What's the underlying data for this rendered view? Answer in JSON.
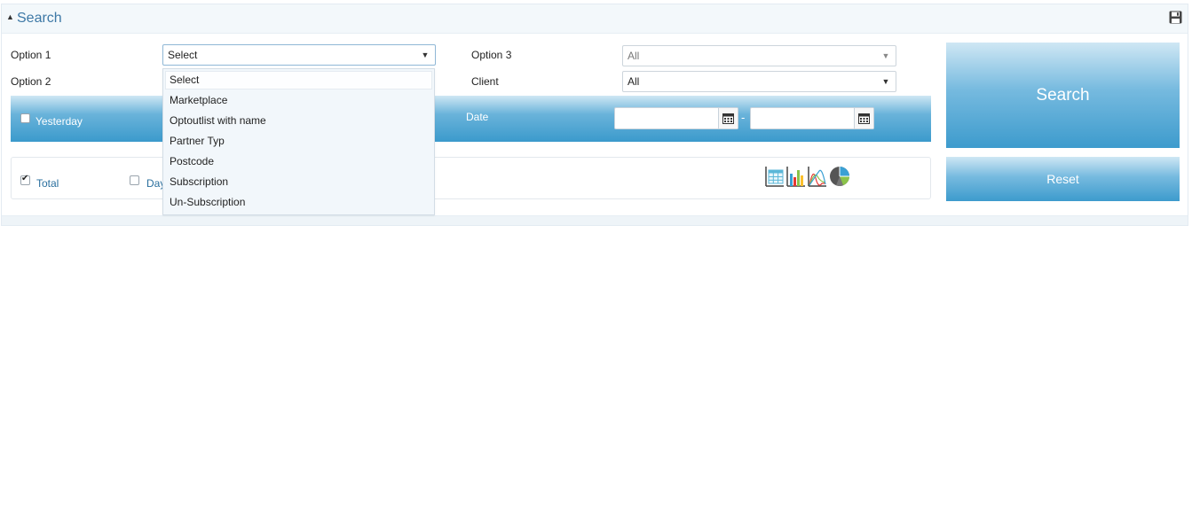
{
  "panel": {
    "title": "Search"
  },
  "form": {
    "option1_label": "Option 1",
    "option2_label": "Option 2",
    "option3_label": "Option 3",
    "client_label": "Client",
    "option1_value": "Select",
    "option3_value": "All",
    "client_value": "All"
  },
  "dropdown": {
    "items": [
      "Select",
      "Marketplace",
      "Optoutlist with name",
      "Partner Typ",
      "Postcode",
      "Subscription",
      "Un-Subscription"
    ]
  },
  "filter_bar": {
    "yesterday_label": "Yesterday",
    "yesterday_checked": false,
    "date_label": "Date",
    "date_from": "",
    "date_to": "",
    "separator": "-"
  },
  "options": {
    "total_label": "Total",
    "total_checked": true,
    "day_label": "Day",
    "day_checked": false
  },
  "buttons": {
    "search_label": "Search",
    "reset_label": "Reset"
  },
  "colors": {
    "accent": "#3d9bcd",
    "title": "#3d78a6",
    "link": "#2a6f9e"
  }
}
